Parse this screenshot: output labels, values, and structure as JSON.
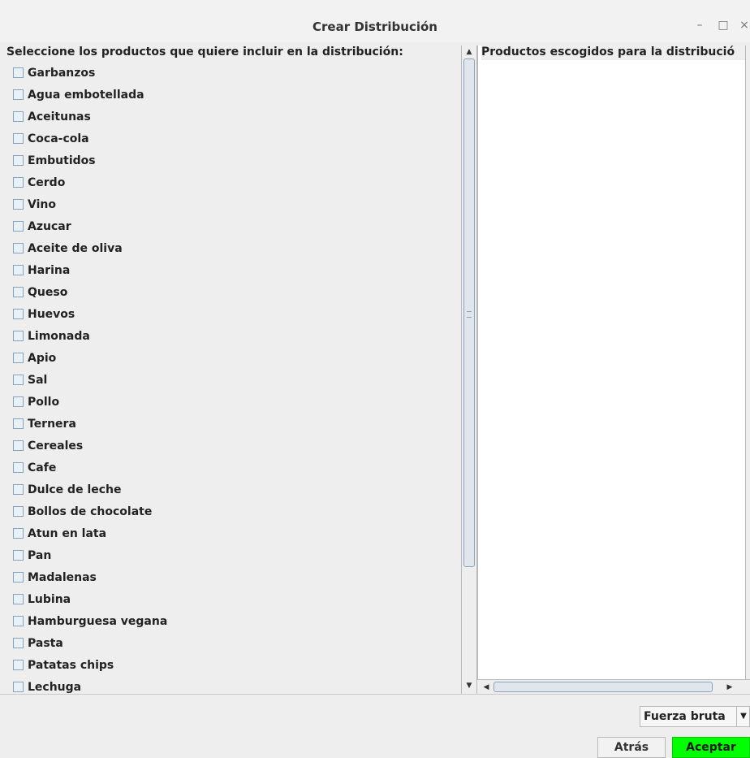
{
  "window": {
    "title": "Crear Distribución",
    "controls": {
      "minimize": "–",
      "maximize": "□",
      "close": "×"
    }
  },
  "left": {
    "header": "Seleccione los productos que quiere incluir en la distribución:",
    "items": [
      "Garbanzos",
      "Agua embotellada",
      "Aceitunas",
      "Coca-cola",
      "Embutidos",
      "Cerdo",
      "Vino",
      "Azucar",
      "Aceite de oliva",
      "Harina",
      "Queso",
      "Huevos",
      "Limonada",
      "Apio",
      "Sal",
      "Pollo",
      "Ternera",
      "Cereales",
      "Cafe",
      "Dulce de leche",
      "Bollos de chocolate",
      "Atun en lata",
      "Pan",
      "Madalenas",
      "Lubina",
      "Hamburguesa vegana",
      "Pasta",
      "Patatas chips",
      "Lechuga"
    ]
  },
  "right": {
    "header": "Productos escogidos para la distribució"
  },
  "bottom": {
    "algorithm_selected": "Fuerza bruta",
    "back_label": "Atrás",
    "accept_label": "Aceptar"
  },
  "colors": {
    "accept_green": "#00ff00",
    "background": "#eeeeee"
  }
}
